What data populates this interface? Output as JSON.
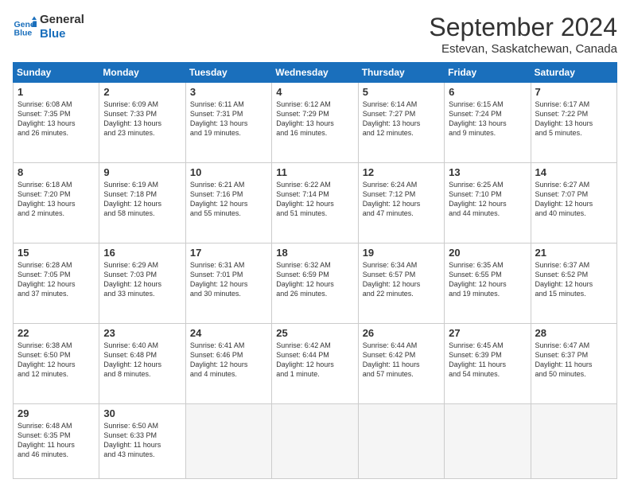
{
  "header": {
    "logo_line1": "General",
    "logo_line2": "Blue",
    "month": "September 2024",
    "location": "Estevan, Saskatchewan, Canada"
  },
  "weekdays": [
    "Sunday",
    "Monday",
    "Tuesday",
    "Wednesday",
    "Thursday",
    "Friday",
    "Saturday"
  ],
  "weeks": [
    [
      {
        "day": "1",
        "info": "Sunrise: 6:08 AM\nSunset: 7:35 PM\nDaylight: 13 hours\nand 26 minutes."
      },
      {
        "day": "2",
        "info": "Sunrise: 6:09 AM\nSunset: 7:33 PM\nDaylight: 13 hours\nand 23 minutes."
      },
      {
        "day": "3",
        "info": "Sunrise: 6:11 AM\nSunset: 7:31 PM\nDaylight: 13 hours\nand 19 minutes."
      },
      {
        "day": "4",
        "info": "Sunrise: 6:12 AM\nSunset: 7:29 PM\nDaylight: 13 hours\nand 16 minutes."
      },
      {
        "day": "5",
        "info": "Sunrise: 6:14 AM\nSunset: 7:27 PM\nDaylight: 13 hours\nand 12 minutes."
      },
      {
        "day": "6",
        "info": "Sunrise: 6:15 AM\nSunset: 7:24 PM\nDaylight: 13 hours\nand 9 minutes."
      },
      {
        "day": "7",
        "info": "Sunrise: 6:17 AM\nSunset: 7:22 PM\nDaylight: 13 hours\nand 5 minutes."
      }
    ],
    [
      {
        "day": "8",
        "info": "Sunrise: 6:18 AM\nSunset: 7:20 PM\nDaylight: 13 hours\nand 2 minutes."
      },
      {
        "day": "9",
        "info": "Sunrise: 6:19 AM\nSunset: 7:18 PM\nDaylight: 12 hours\nand 58 minutes."
      },
      {
        "day": "10",
        "info": "Sunrise: 6:21 AM\nSunset: 7:16 PM\nDaylight: 12 hours\nand 55 minutes."
      },
      {
        "day": "11",
        "info": "Sunrise: 6:22 AM\nSunset: 7:14 PM\nDaylight: 12 hours\nand 51 minutes."
      },
      {
        "day": "12",
        "info": "Sunrise: 6:24 AM\nSunset: 7:12 PM\nDaylight: 12 hours\nand 47 minutes."
      },
      {
        "day": "13",
        "info": "Sunrise: 6:25 AM\nSunset: 7:10 PM\nDaylight: 12 hours\nand 44 minutes."
      },
      {
        "day": "14",
        "info": "Sunrise: 6:27 AM\nSunset: 7:07 PM\nDaylight: 12 hours\nand 40 minutes."
      }
    ],
    [
      {
        "day": "15",
        "info": "Sunrise: 6:28 AM\nSunset: 7:05 PM\nDaylight: 12 hours\nand 37 minutes."
      },
      {
        "day": "16",
        "info": "Sunrise: 6:29 AM\nSunset: 7:03 PM\nDaylight: 12 hours\nand 33 minutes."
      },
      {
        "day": "17",
        "info": "Sunrise: 6:31 AM\nSunset: 7:01 PM\nDaylight: 12 hours\nand 30 minutes."
      },
      {
        "day": "18",
        "info": "Sunrise: 6:32 AM\nSunset: 6:59 PM\nDaylight: 12 hours\nand 26 minutes."
      },
      {
        "day": "19",
        "info": "Sunrise: 6:34 AM\nSunset: 6:57 PM\nDaylight: 12 hours\nand 22 minutes."
      },
      {
        "day": "20",
        "info": "Sunrise: 6:35 AM\nSunset: 6:55 PM\nDaylight: 12 hours\nand 19 minutes."
      },
      {
        "day": "21",
        "info": "Sunrise: 6:37 AM\nSunset: 6:52 PM\nDaylight: 12 hours\nand 15 minutes."
      }
    ],
    [
      {
        "day": "22",
        "info": "Sunrise: 6:38 AM\nSunset: 6:50 PM\nDaylight: 12 hours\nand 12 minutes."
      },
      {
        "day": "23",
        "info": "Sunrise: 6:40 AM\nSunset: 6:48 PM\nDaylight: 12 hours\nand 8 minutes."
      },
      {
        "day": "24",
        "info": "Sunrise: 6:41 AM\nSunset: 6:46 PM\nDaylight: 12 hours\nand 4 minutes."
      },
      {
        "day": "25",
        "info": "Sunrise: 6:42 AM\nSunset: 6:44 PM\nDaylight: 12 hours\nand 1 minute."
      },
      {
        "day": "26",
        "info": "Sunrise: 6:44 AM\nSunset: 6:42 PM\nDaylight: 11 hours\nand 57 minutes."
      },
      {
        "day": "27",
        "info": "Sunrise: 6:45 AM\nSunset: 6:39 PM\nDaylight: 11 hours\nand 54 minutes."
      },
      {
        "day": "28",
        "info": "Sunrise: 6:47 AM\nSunset: 6:37 PM\nDaylight: 11 hours\nand 50 minutes."
      }
    ],
    [
      {
        "day": "29",
        "info": "Sunrise: 6:48 AM\nSunset: 6:35 PM\nDaylight: 11 hours\nand 46 minutes."
      },
      {
        "day": "30",
        "info": "Sunrise: 6:50 AM\nSunset: 6:33 PM\nDaylight: 11 hours\nand 43 minutes."
      },
      {
        "day": "",
        "info": ""
      },
      {
        "day": "",
        "info": ""
      },
      {
        "day": "",
        "info": ""
      },
      {
        "day": "",
        "info": ""
      },
      {
        "day": "",
        "info": ""
      }
    ]
  ]
}
